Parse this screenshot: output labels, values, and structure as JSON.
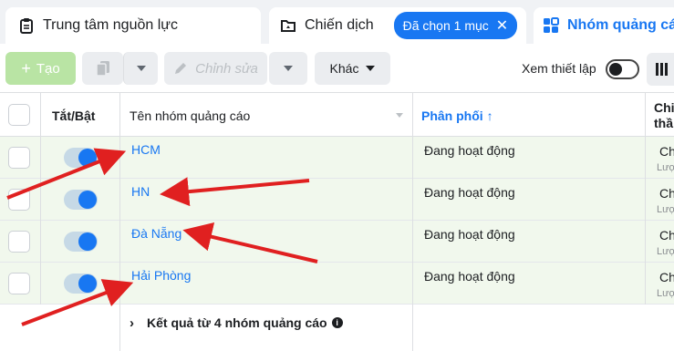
{
  "tabs": {
    "resources": "Trung tâm nguồn lực",
    "campaigns": "Chiến dịch",
    "campaigns_chip": "Đã chọn 1 mục",
    "adsets": "Nhóm quảng cá"
  },
  "toolbar": {
    "create": "Tạo",
    "edit": "Chỉnh sửa",
    "more": "Khác",
    "view_settings": "Xem thiết lập"
  },
  "table": {
    "headers": {
      "toggle": "Tắt/Bật",
      "name": "Tên nhóm quảng cáo",
      "delivery": "Phân phối",
      "objective_line1": "Chi",
      "objective_line2": "thầ"
    },
    "rows": [
      {
        "name": "HCM",
        "delivery": "Đang hoạt động",
        "obj": "Ch",
        "obj_sub": "Lượ"
      },
      {
        "name": "HN",
        "delivery": "Đang hoạt động",
        "obj": "Ch",
        "obj_sub": "Lượ"
      },
      {
        "name": "Đà Nẵng",
        "delivery": "Đang hoạt động",
        "obj": "Ch",
        "obj_sub": "Lượ"
      },
      {
        "name": "Hải Phòng",
        "delivery": "Đang hoạt động",
        "obj": "Ch",
        "obj_sub": "Lượ"
      }
    ],
    "footer": "Kết quả từ 4 nhóm quảng cáo"
  },
  "colors": {
    "accent": "#1877f2",
    "row_bg": "#f1f8ed",
    "arrow": "#e02020"
  }
}
